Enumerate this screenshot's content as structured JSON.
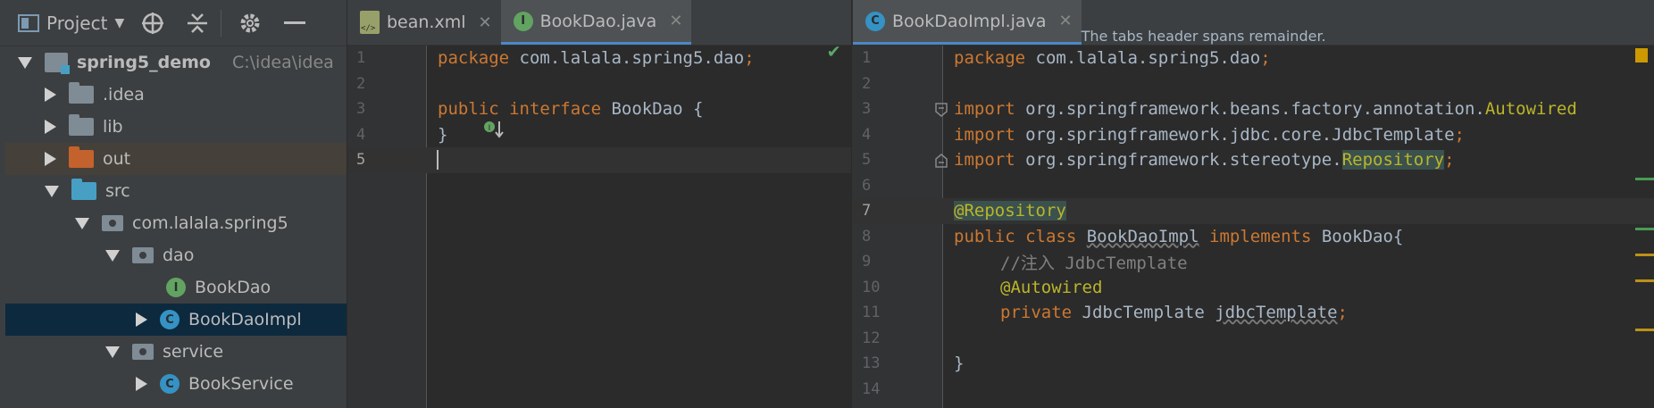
{
  "project_panel": {
    "title": "Project",
    "tree": [
      {
        "label": "spring5_demo",
        "path": "C:\\idea\\idea"
      },
      {
        "label": ".idea"
      },
      {
        "label": "lib"
      },
      {
        "label": "out"
      },
      {
        "label": "src"
      },
      {
        "label": "com.lalala.spring5"
      },
      {
        "label": "dao"
      },
      {
        "label": "BookDao",
        "badge": "I"
      },
      {
        "label": "BookDaoImpl",
        "badge": "C"
      },
      {
        "label": "service"
      },
      {
        "label": "BookService",
        "badge": "C"
      }
    ]
  },
  "left_editor": {
    "tabs": [
      {
        "label": "bean.xml"
      },
      {
        "label": "BookDao.java",
        "badge": "I"
      }
    ],
    "line_numbers": [
      "1",
      "2",
      "3",
      "4",
      "5"
    ],
    "code": {
      "l1_kw": "package",
      "l1_rest": " com.lalala.spring5.dao",
      "l1_semi": ";",
      "l3_kw": "public interface",
      "l3_rest": " BookDao {",
      "l4": "}"
    }
  },
  "right_editor": {
    "tabs": [
      {
        "label": "BookDaoImpl.java",
        "badge": "C"
      }
    ],
    "line_numbers": [
      "1",
      "2",
      "3",
      "4",
      "5",
      "6",
      "7",
      "8",
      "9",
      "10",
      "11",
      "12",
      "13",
      "14"
    ],
    "code": {
      "l1_kw": "package",
      "l1_rest": " com.lalala.spring5.dao",
      "l1_semi": ";",
      "l3_kw": "import",
      "l3_rest": " org.springframework.beans.factory.annotation.",
      "l3_ann": "Autowired",
      "l4_kw": "import",
      "l4_rest": " org.springframework.jdbc.core.JdbcTemplate",
      "l4_semi": ";",
      "l5_kw": "import",
      "l5_rest": " org.springframework.stereotype.",
      "l5_ann": "Repository",
      "l5_semi": ";",
      "l7_ann": "@Repository",
      "l8_kw1": "public class",
      "l8_cls": "BookDaoImpl",
      "l8_kw2": "implements",
      "l8_rest": " BookDao{",
      "l9_cm": "//注入 JdbcTemplate",
      "l10_ann": "@Autowired",
      "l11_kw": "private",
      "l11_type": " JdbcTemplate ",
      "l11_field": "jdbcTemplate",
      "l11_semi": ";",
      "l13": "}"
    }
  },
  "colors": {
    "keyword": "#cc7832",
    "annotation": "#bbb529",
    "comment": "#808080",
    "text": "#a9b7c6",
    "selection": "#0d293e"
  }
}
